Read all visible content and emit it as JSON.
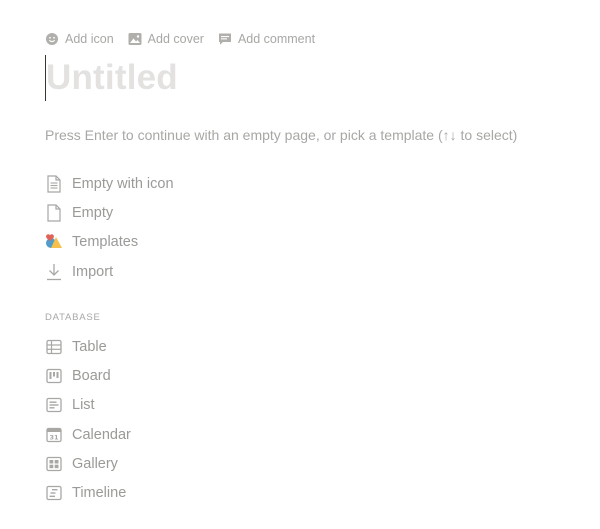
{
  "toolbar": {
    "add_icon": "Add icon",
    "add_cover": "Add cover",
    "add_comment": "Add comment"
  },
  "page": {
    "title_placeholder": "Untitled",
    "hint": "Press Enter to continue with an empty page, or pick a template (↑↓ to select)"
  },
  "start_options": [
    {
      "label": "Empty with icon",
      "icon": "page-with-lines-icon"
    },
    {
      "label": "Empty",
      "icon": "page-icon"
    },
    {
      "label": "Templates",
      "icon": "templates-icon"
    },
    {
      "label": "Import",
      "icon": "download-arrow-icon"
    }
  ],
  "database": {
    "section_label": "DATABASE",
    "items": [
      {
        "label": "Table",
        "icon": "table-icon"
      },
      {
        "label": "Board",
        "icon": "board-icon"
      },
      {
        "label": "List",
        "icon": "list-icon"
      },
      {
        "label": "Calendar",
        "icon": "calendar-icon"
      },
      {
        "label": "Gallery",
        "icon": "gallery-icon"
      },
      {
        "label": "Timeline",
        "icon": "timeline-icon"
      }
    ]
  },
  "colors": {
    "icon_gray": "#a8a7a4",
    "title_placeholder": "#e3e2e0",
    "templates_red": "#e16259",
    "templates_blue": "#529cca",
    "templates_yellow": "#f7c04a"
  }
}
